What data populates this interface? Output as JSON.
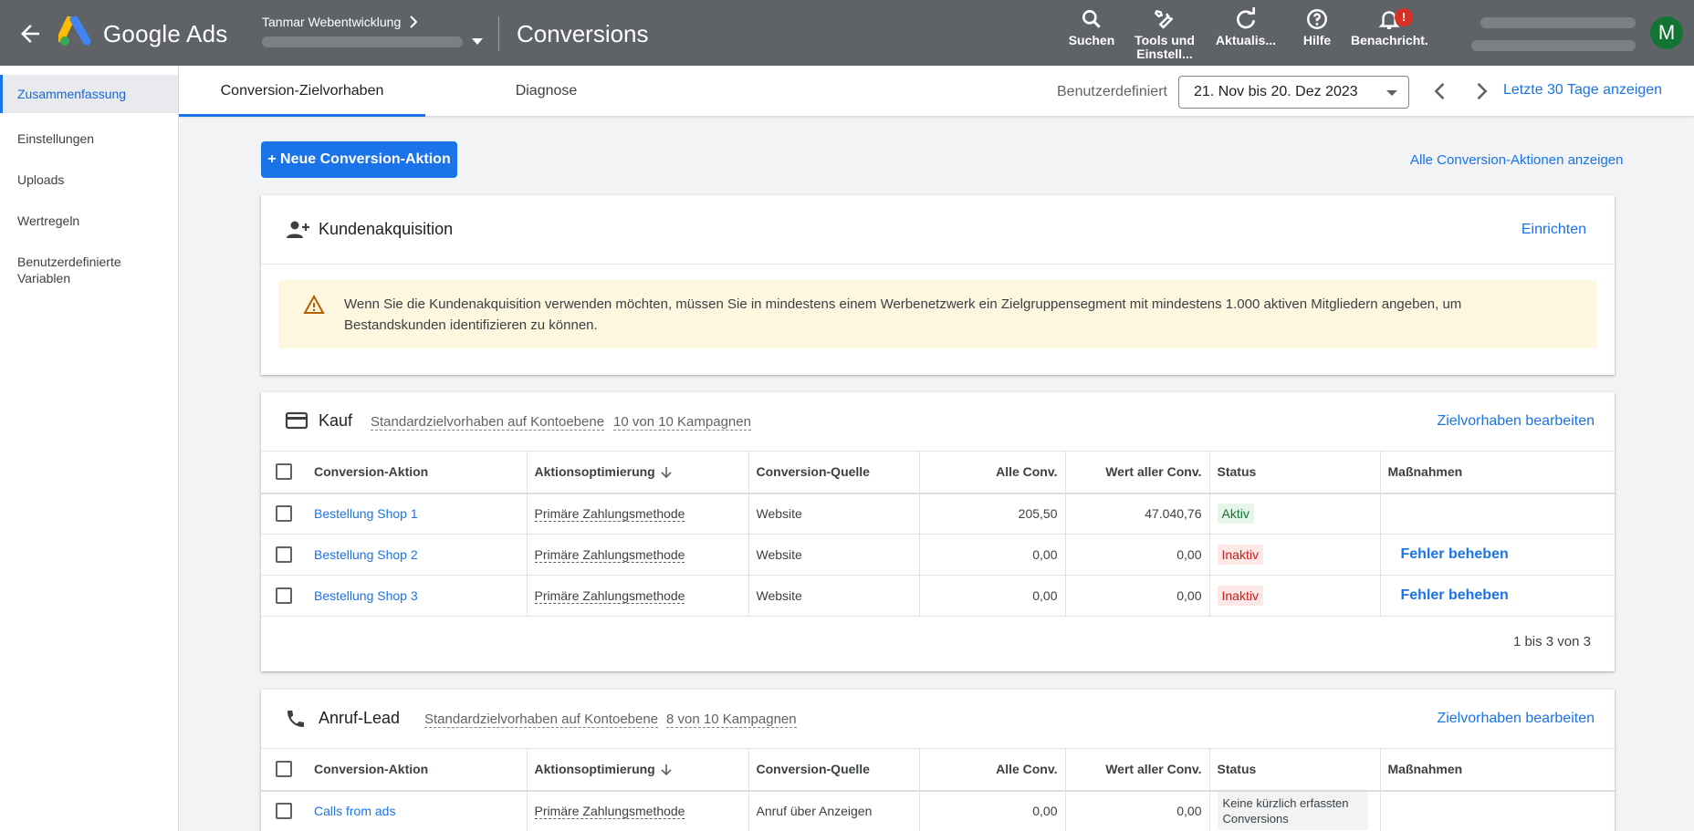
{
  "header": {
    "brand": "Google Ads",
    "account_name": "Tanmar Webentwicklung",
    "page_title": "Conversions",
    "tools": [
      {
        "icon": "search-icon",
        "label": "Suchen"
      },
      {
        "icon": "wrench-icon",
        "label": "Tools und Einstell..."
      },
      {
        "icon": "refresh-icon",
        "label": "Aktualis..."
      },
      {
        "icon": "help-icon",
        "label": "Hilfe"
      },
      {
        "icon": "bell-icon",
        "label": "Benachricht.",
        "badge": "!"
      }
    ],
    "avatar_letter": "M"
  },
  "sidebar": {
    "items": [
      {
        "label": "Zusammenfassung",
        "active": true
      },
      {
        "label": "Einstellungen"
      },
      {
        "label": "Uploads"
      },
      {
        "label": "Wertregeln"
      },
      {
        "label": "Benutzerdefinierte Variablen"
      }
    ]
  },
  "tabs": {
    "items": [
      {
        "label": "Conversion-Zielvorhaben",
        "active": true
      },
      {
        "label": "Diagnose"
      }
    ],
    "date_label": "Benutzerdefiniert",
    "date_range": "21. Nov bis 20. Dez 2023",
    "last30_label": "Letzte 30 Tage anzeigen"
  },
  "content": {
    "new_button": "+ Neue Conversion-Aktion",
    "all_link": "Alle Conversion-Aktionen anzeigen"
  },
  "acquisition": {
    "title": "Kundenakquisition",
    "action": "Einrichten",
    "warning": "Wenn Sie die Kundenakquisition verwenden möchten, müssen Sie in mindestens einem Werbenetzwerk ein Zielgruppensegment mit mindestens 1.000 aktiven Mitgliedern angeben, um Bestandskunden identifizieren zu können."
  },
  "columns": [
    "Conversion-Aktion",
    "Aktionsoptimierung",
    "Conversion-Quelle",
    "Alle Conv.",
    "Wert aller Conv.",
    "Status",
    "Maßnahmen"
  ],
  "kauf": {
    "title": "Kauf",
    "meta1": "Standardzielvorhaben auf Kontoebene",
    "meta2": "10 von 10 Kampagnen",
    "action": "Zielvorhaben bearbeiten",
    "rows": [
      {
        "name": "Bestellung Shop 1",
        "opt": "Primäre Zahlungsmethode",
        "source": "Website",
        "conv": "205,50",
        "value": "47.040,76",
        "status": "Aktiv",
        "fix": ""
      },
      {
        "name": "Bestellung Shop 2",
        "opt": "Primäre Zahlungsmethode",
        "source": "Website",
        "conv": "0,00",
        "value": "0,00",
        "status": "Inaktiv",
        "fix": "Fehler beheben"
      },
      {
        "name": "Bestellung Shop 3",
        "opt": "Primäre Zahlungsmethode",
        "source": "Website",
        "conv": "0,00",
        "value": "0,00",
        "status": "Inaktiv",
        "fix": "Fehler beheben"
      }
    ],
    "pager": "1 bis 3 von 3"
  },
  "anruf": {
    "title": "Anruf-Lead",
    "meta1": "Standardzielvorhaben auf Kontoebene",
    "meta2": "8 von 10 Kampagnen",
    "action": "Zielvorhaben bearbeiten",
    "rows": [
      {
        "name": "Calls from ads",
        "opt": "Primäre Zahlungsmethode",
        "source": "Anruf über Anzeigen",
        "conv": "0,00",
        "value": "0,00",
        "status": "Keine kürzlich erfassten Conversions"
      }
    ]
  }
}
